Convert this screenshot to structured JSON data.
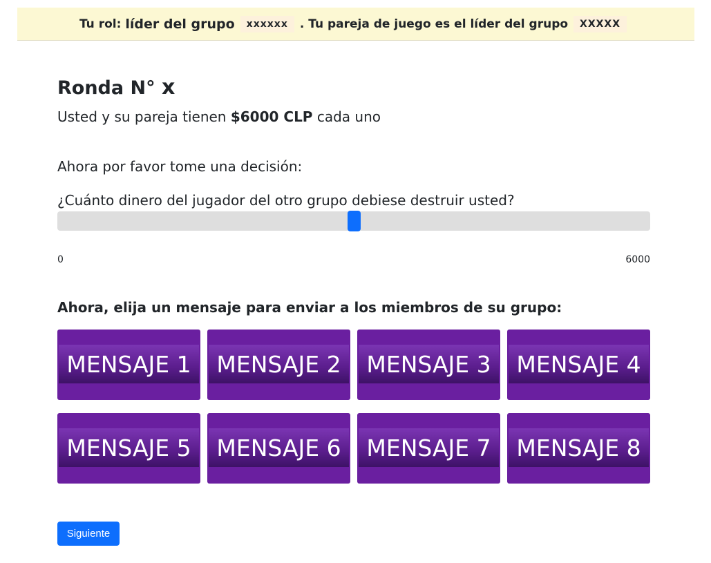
{
  "header": {
    "role_prefix": "Tu rol:",
    "role": "líder del grupo",
    "own_group_masked": "xxxxxx",
    "partner_text": ". Tu pareja de juego es el líder del grupo",
    "partner_group_masked": "XXXXX"
  },
  "round": {
    "label": "Ronda N°",
    "number": "x"
  },
  "endowment": {
    "prefix": "Usted y su pareja tienen",
    "amount": "$6000 CLP",
    "suffix": "cada uno"
  },
  "decision_prompt": "Ahora por favor tome una decisión:",
  "slider": {
    "question": "¿Cuánto dinero del jugador del otro grupo debiese destruir usted?",
    "min_label": "0",
    "max_label": "6000",
    "min": 0,
    "max": 6000,
    "value": 3000,
    "thumb_color": "#0d6efd",
    "track_color": "#dedede"
  },
  "messages": {
    "heading": "Ahora, elija un mensaje para enviar a los miembros de su grupo:",
    "button_color": "#6a1fa0",
    "items": [
      {
        "label": "MENSAJE 1"
      },
      {
        "label": "MENSAJE 2"
      },
      {
        "label": "MENSAJE 3"
      },
      {
        "label": "MENSAJE 4"
      },
      {
        "label": "MENSAJE 5"
      },
      {
        "label": "MENSAJE 6"
      },
      {
        "label": "MENSAJE 7"
      },
      {
        "label": "MENSAJE 8"
      }
    ]
  },
  "next_button": {
    "label": "Siguiente",
    "color": "#0d6efd"
  }
}
